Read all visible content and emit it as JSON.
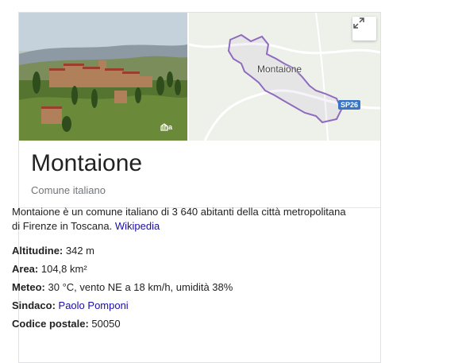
{
  "title": "Montaione",
  "subtitle": "Comune italiano",
  "map": {
    "label": "Montaione",
    "road_badge": "SP26"
  },
  "photo": {
    "watermark": "iha"
  },
  "description": {
    "text": "Montaione è un comune italiano di 3 640 abitanti della città metropolitana di Firenze in Toscana. ",
    "link": "Wikipedia"
  },
  "facts": [
    {
      "label": "Altitudine:",
      "value": " 342 m",
      "link": ""
    },
    {
      "label": "Area:",
      "value": " 104,8 km²",
      "link": ""
    },
    {
      "label": "Meteo:",
      "value": " 30 °C, vento NE a 18 km/h, umidità 38%",
      "link": ""
    },
    {
      "label": "Sindaco:",
      "value": " ",
      "link": "Paolo Pomponi"
    },
    {
      "label": "Codice postale:",
      "value": " 50050",
      "link": ""
    }
  ],
  "icons": {
    "expand": "expand-icon",
    "camera": "camera-icon"
  },
  "colors": {
    "link": "#1a0dab",
    "boundary": "#8e6bbf",
    "road_badge": "#3a75c4"
  }
}
